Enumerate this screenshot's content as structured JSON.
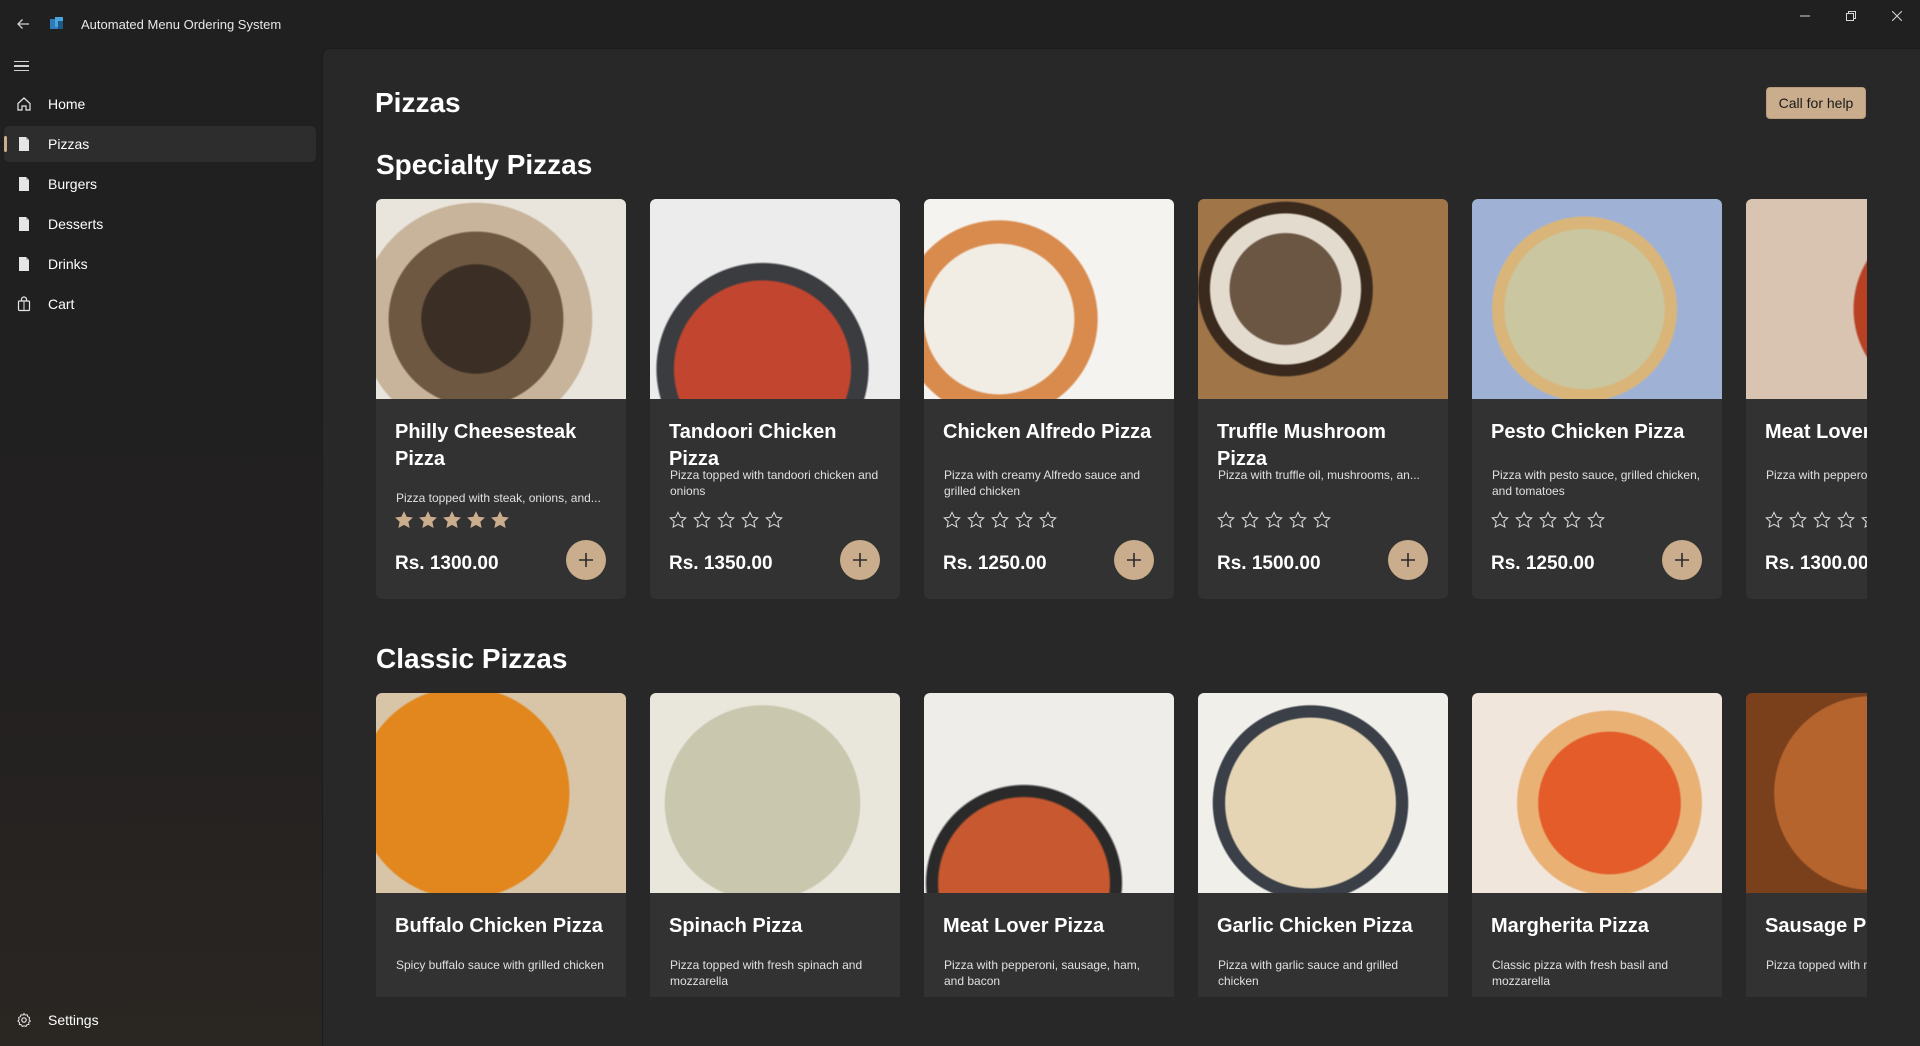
{
  "app": {
    "title": "Automated Menu Ordering System"
  },
  "sidebar": {
    "items": [
      {
        "label": "Home",
        "icon": "home-icon"
      },
      {
        "label": "Pizzas",
        "icon": "document-icon",
        "active": true
      },
      {
        "label": "Burgers",
        "icon": "document-icon"
      },
      {
        "label": "Desserts",
        "icon": "document-icon"
      },
      {
        "label": "Drinks",
        "icon": "document-icon"
      },
      {
        "label": "Cart",
        "icon": "shopping-bag-icon"
      }
    ],
    "settings_label": "Settings"
  },
  "page": {
    "title": "Pizzas",
    "help_button": "Call for help"
  },
  "colors": {
    "accent": "#c9ad8c",
    "card_bg": "#323232",
    "content_bg": "#282828",
    "sidebar_bg": "#202020"
  },
  "sections": [
    {
      "title": "Specialty Pizzas",
      "items": [
        {
          "name": "Philly Cheesesteak Pizza",
          "desc": "Pizza topped with steak, onions, and...",
          "rating": 5,
          "price": "Rs. 1300.00",
          "image": "dark-steak-pizza-photo"
        },
        {
          "name": "Tandoori Chicken Pizza",
          "desc": "Pizza topped with tandoori chicken and onions",
          "rating": 0,
          "price": "Rs. 1350.00",
          "image": "red-tandoori-pizza-photo"
        },
        {
          "name": "Chicken Alfredo Pizza",
          "desc": "Pizza with creamy Alfredo sauce and grilled chicken",
          "rating": 0,
          "price": "Rs. 1250.00",
          "image": "white-alfredo-pizza-photo"
        },
        {
          "name": "Truffle Mushroom Pizza",
          "desc": "Pizza with truffle oil, mushrooms, an...",
          "rating": 0,
          "price": "Rs. 1500.00",
          "image": "mushroom-pizza-photo"
        },
        {
          "name": "Pesto Chicken Pizza",
          "desc": "Pizza with pesto sauce, grilled chicken, and tomatoes",
          "rating": 0,
          "price": "Rs. 1250.00",
          "image": "pesto-pizza-photo"
        },
        {
          "name": "Meat Lover",
          "desc": "Pizza with pepperoni, bacon",
          "rating": 0,
          "price": "Rs. 1300.00",
          "image": "pepperoni-pizza-photo"
        }
      ]
    },
    {
      "title": "Classic Pizzas",
      "items": [
        {
          "name": "Buffalo Chicken Pizza",
          "desc": "Spicy buffalo sauce with grilled chicken",
          "image": "buffalo-pizza-photo"
        },
        {
          "name": "Spinach Pizza",
          "desc": "Pizza topped with fresh spinach and mozzarella",
          "image": "spinach-pizza-photo"
        },
        {
          "name": "Meat Lover Pizza",
          "desc": "Pizza with pepperoni, sausage, ham, and bacon",
          "image": "meat-lover-pizza-photo"
        },
        {
          "name": "Garlic Chicken Pizza",
          "desc": "Pizza with garlic sauce and grilled chicken",
          "image": "garlic-chicken-pizza-photo"
        },
        {
          "name": "Margherita Pizza",
          "desc": "Classic pizza with fresh basil and mozzarella",
          "image": "margherita-pizza-photo"
        },
        {
          "name": "Sausage Pi",
          "desc": "Pizza topped with mozzarella",
          "image": "sausage-pizza-photo"
        }
      ]
    }
  ]
}
